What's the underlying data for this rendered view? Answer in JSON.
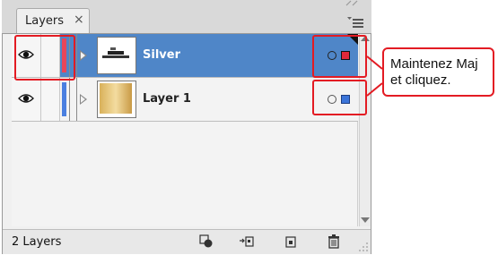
{
  "panel": {
    "tab_label": "Layers",
    "tab_close": "×"
  },
  "layers": [
    {
      "name": "Silver",
      "selected": true,
      "color": "#e8465a",
      "thumbnail": "silver-logo-thumbnail",
      "indicator_color": "#e0283a"
    },
    {
      "name": "Layer 1",
      "selected": false,
      "color": "#4a7fe0",
      "thumbnail": "gold-gradient-thumbnail",
      "indicator_color": "#3b74d9"
    }
  ],
  "footer": {
    "layer_count": "2 Layers"
  },
  "annotation": {
    "callout_text": "Maintenez Maj et cliquez.",
    "highlight_color": "#e31b23"
  },
  "colors": {
    "selection_blue": "#4f86c8"
  }
}
